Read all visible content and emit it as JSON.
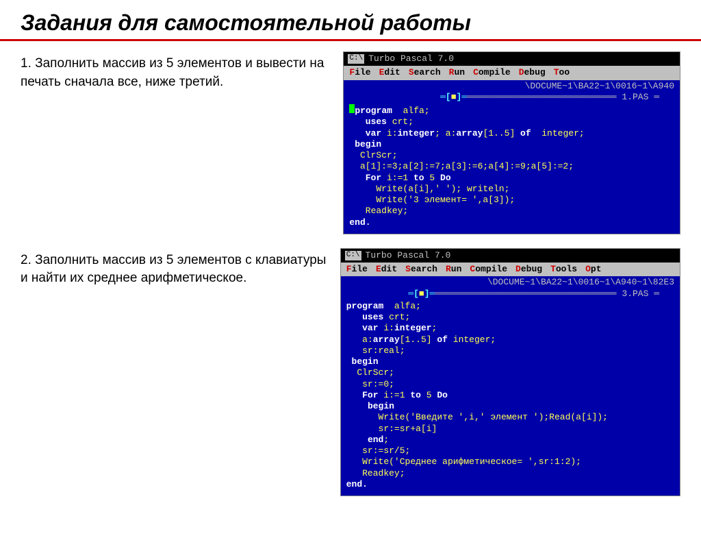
{
  "title": "Задания для самостоятельной работы",
  "task1": "1. Заполнить массив из 5 элементов и вывести на печать сначала все, ниже третий.",
  "task2": "2. Заполнить массив из 5 элементов с клавиатуры и найти их среднее арифметическое.",
  "tp_title": "Turbo Pascal 7.0",
  "tp_icon": "C:\\",
  "menu": {
    "file": "File",
    "edit": "Edit",
    "search": "Search",
    "run": "Run",
    "compile": "Compile",
    "debug": "Debug",
    "tools": "Tools",
    "opt": "Opt"
  },
  "menu_short": {
    "tools_cut": "Too"
  },
  "path1": "\\DOCUME~1\\BA22~1\\0016~1\\A940",
  "path2": "\\DOCUME~1\\BA22~1\\0016~1\\A940~1\\82E3",
  "file1": "1.PAS ═",
  "file2": "3.PAS ═",
  "code1": {
    "l1a": "program",
    "l1b": "  alfa;",
    "l2a": "uses",
    "l2b": " crt;",
    "l3a": "var",
    "l3b": " i:",
    "l3c": "integer",
    "l3d": "; a:",
    "l3e": "array",
    "l3f": "[1..5] ",
    "l3g": "of",
    "l3h": "  integer;",
    "l4": "begin",
    "l5": " ClrScr;",
    "l6": "  a[1]:=3;a[2]:=7;a[3]:=6;a[4]:=9;a[5]:=2;",
    "l7a": "For",
    "l7b": " i:=1 ",
    "l7c": "to",
    "l7d": " 5 ",
    "l7e": "Do",
    "l8": "     Write(a[i],' '); writeln;",
    "l9": "     Write('3 элемент= ',a[3]);",
    "l10": "   Readkey;",
    "l11": "end."
  },
  "code2": {
    "l1a": "program",
    "l1b": "  alfa;",
    "l2a": "uses",
    "l2b": " crt;",
    "l3a": "var",
    "l3b": " i:",
    "l3c": "integer",
    "l3d": ";",
    "l4a": "   a:",
    "l4b": "array",
    "l4c": "[1..5] ",
    "l4d": "of",
    "l4e": " integer;",
    "l5": "   sr:real;",
    "l6": "begin",
    "l7": " ClrScr;",
    "l8": "   sr:=0;",
    "l9a": "For",
    "l9b": " i:=1 ",
    "l9c": "to",
    "l9d": " 5 ",
    "l9e": "Do",
    "l10": "begin",
    "l11": "      Write('Введите ',i,' элемент ');Read(a[i]);",
    "l12": "      sr:=sr+a[i]",
    "l13": "end",
    "l14": "   sr:=sr/5;",
    "l15": "   Write('Среднее арифметическое= ',sr:1:2);",
    "l16": "   Readkey;",
    "l17": "end."
  },
  "frame_left": "═[",
  "frame_right": "]═",
  "block": "■"
}
